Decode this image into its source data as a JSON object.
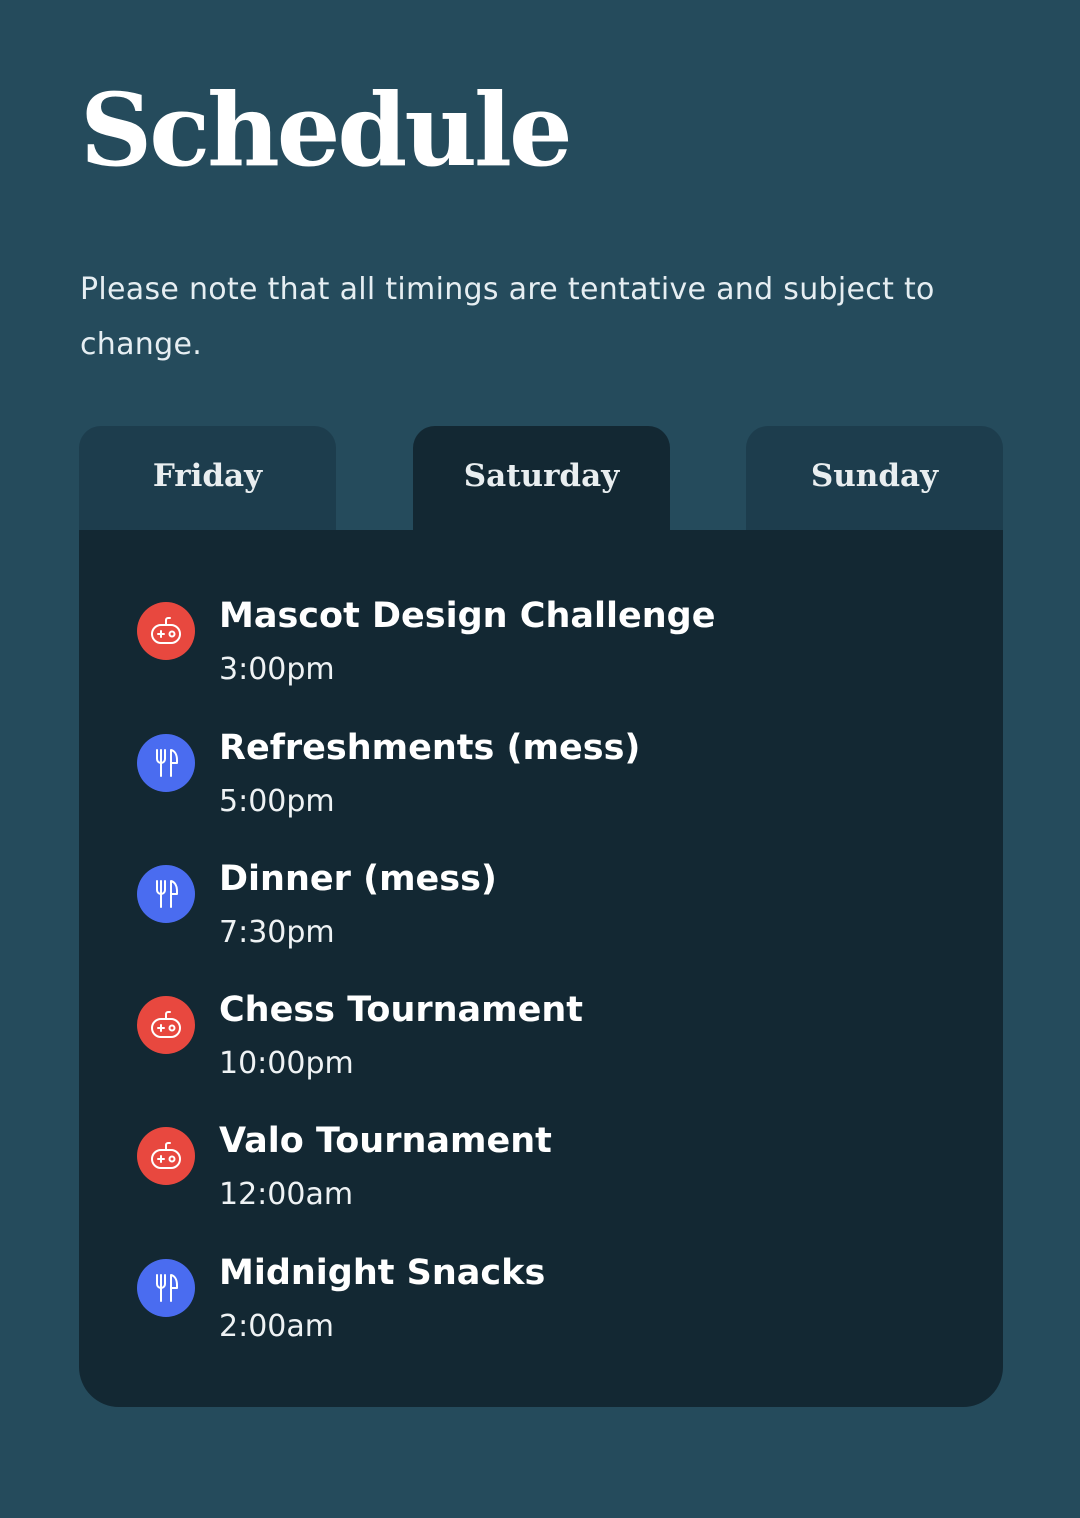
{
  "header": {
    "title": "Schedule",
    "note": "Please note that all timings are tentative and subject to change."
  },
  "tabs": [
    {
      "label": "Friday",
      "active": false
    },
    {
      "label": "Saturday",
      "active": true
    },
    {
      "label": "Sunday",
      "active": false
    }
  ],
  "colors": {
    "background": "#254b5c",
    "panel": "#132833",
    "inactive_tab": "#1d3d4d",
    "game_icon": "#e8483f",
    "food_icon": "#4a6cf0"
  },
  "events": [
    {
      "title": "Mascot Design Challenge",
      "time": "3:00pm",
      "icon": "gamepad-icon"
    },
    {
      "title": "Refreshments (mess)",
      "time": "5:00pm",
      "icon": "utensils-icon"
    },
    {
      "title": "Dinner (mess)",
      "time": "7:30pm",
      "icon": "utensils-icon"
    },
    {
      "title": "Chess Tournament",
      "time": "10:00pm",
      "icon": "gamepad-icon"
    },
    {
      "title": "Valo Tournament",
      "time": "12:00am",
      "icon": "gamepad-icon"
    },
    {
      "title": "Midnight Snacks",
      "time": "2:00am",
      "icon": "utensils-icon"
    }
  ]
}
